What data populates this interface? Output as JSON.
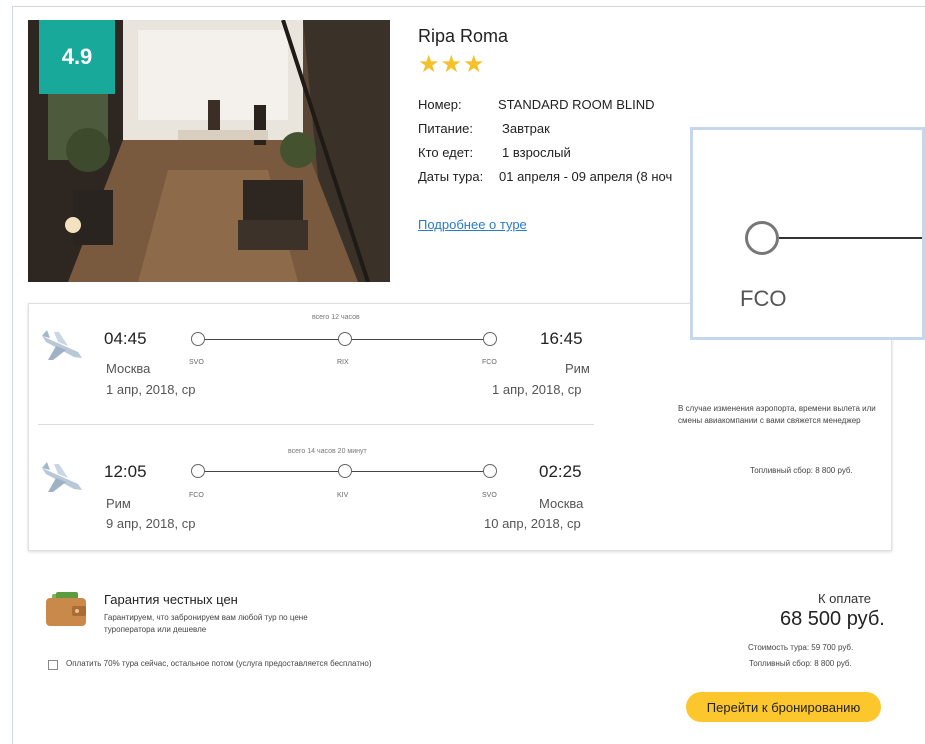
{
  "hotel": {
    "rating": "4.9",
    "name": "Ripa Roma",
    "stars": "★★★",
    "details": [
      {
        "label": "Номер:",
        "value": "STANDARD ROOM BLIND"
      },
      {
        "label": "Питание:",
        "value": "Завтрак"
      },
      {
        "label": "Кто едет:",
        "value": "1 взрослый"
      },
      {
        "label": "Даты тура:",
        "value": "01 апреля - 09 апреля (8 ноч"
      }
    ],
    "more_link": "Подробнее о туре"
  },
  "flights": {
    "outbound": {
      "duration": "всего 12 часов",
      "depart_time": "04:45",
      "depart_city": "Москва",
      "depart_date": "1 апр, 2018, ср",
      "arrive_time": "16:45",
      "arrive_city": "Рим",
      "arrive_date": "1 апр, 2018, ср",
      "airports": [
        "SVO",
        "RIX",
        "FCO"
      ]
    },
    "return": {
      "duration": "всего 14 часов 20 минут",
      "depart_time": "12:05",
      "depart_city": "Рим",
      "depart_date": "9 апр, 2018, ср",
      "arrive_time": "02:25",
      "arrive_city": "Москва",
      "arrive_date": "10 апр, 2018, ср",
      "airports": [
        "FCO",
        "KIV",
        "SVO"
      ]
    },
    "notice": "В случае изменения аэропорта, времени вылета или смены авиакомпании с вами свяжется менеджер",
    "fuel": "Топливный сбор: 8 800 руб."
  },
  "zoom": {
    "label": "FCO"
  },
  "guarantee": {
    "title": "Гарантия честных цен",
    "text": "Гарантируем, что забронируем вам любой тур по цене туроператора или дешевле",
    "checkbox_label": "Оплатить 70% тура сейчас, остальное потом (услуга предоставляется бесплатно)"
  },
  "payment": {
    "label": "К оплате",
    "total": "68 500 руб.",
    "cost": "Стоимость тура: 59 700 руб.",
    "fuel": "Топливный сбор: 8 800 руб.",
    "button": "Перейти к бронированию"
  },
  "colors": {
    "badge": "#19a99b",
    "stars": "#f5c12a",
    "link": "#2a7bc4",
    "button": "#fcc62d"
  }
}
